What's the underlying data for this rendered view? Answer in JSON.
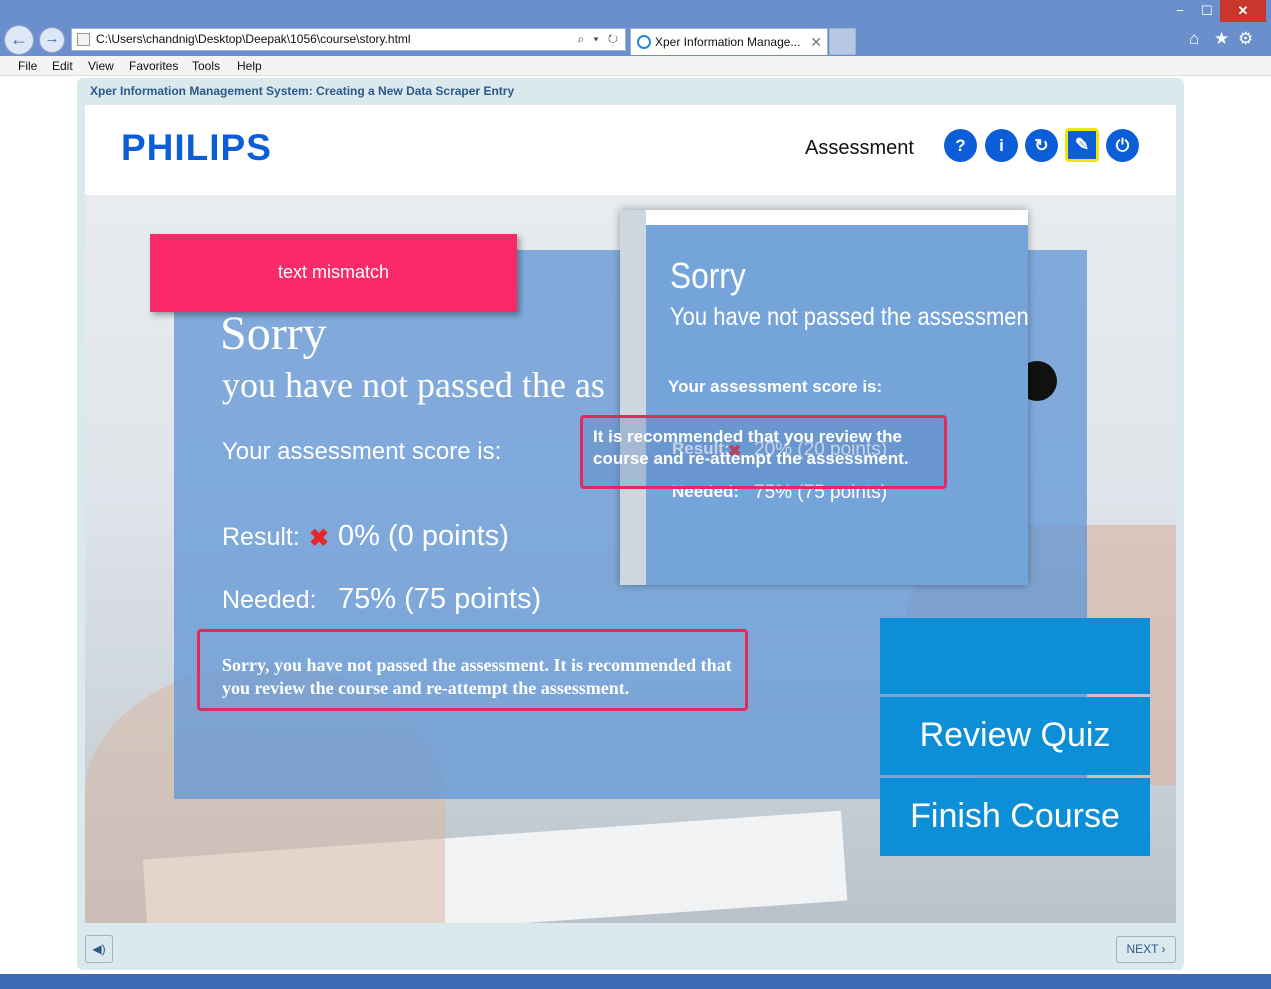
{
  "browser": {
    "address": "C:\\Users\\chandnig\\Desktop\\Deepak\\1056\\course\\story.html",
    "address_tools": "⌕ ▾ ↻",
    "tab_title": "Xper Information Manage...",
    "tab_close": "✕",
    "window_min": "−",
    "window_max": "☐",
    "window_close": "✕",
    "toolbar_icons": {
      "home": "⌂",
      "favorites": "★",
      "tools": "⚙"
    }
  },
  "menu": [
    "File",
    "Edit",
    "View",
    "Favorites",
    "Tools",
    "Help"
  ],
  "course": {
    "title": "Xper Information Management System: Creating a New Data Scraper Entry",
    "brand": "PHILIPS",
    "section": "Assessment",
    "header_buttons": {
      "help": "?",
      "info": "i",
      "replay": "↻",
      "compass": "✎",
      "power": "⏻"
    }
  },
  "result": {
    "sorry": "Sorry",
    "not_passed": "you have not passed the as",
    "score_label": "Your assessment score is:",
    "result_label": "Result:",
    "result_value": "0% (0 points)",
    "needed_label": "Needed:",
    "needed_value": "75% (75 points)",
    "message": "Sorry, you have not passed the assessment. It is recommended that you review the course and re-attempt the assessment."
  },
  "buttons": {
    "review_quiz": "Review Quiz",
    "finish_course": "Finish Course"
  },
  "annotation": {
    "mismatch_tag": "text mismatch"
  },
  "reference": {
    "sorry": "Sorry",
    "not_passed": "You have not passed the assessmen",
    "score_label": "Your assessment score is:",
    "result_label": "Result:",
    "result_value": "20% (20 points)",
    "needed_label": "Needed:",
    "needed_value": "75% (75 points)",
    "message": "It is recommended that you review the course and re-attempt the assessment."
  },
  "footer": {
    "audio": "◀)",
    "next": "NEXT ›"
  },
  "colors": {
    "brand_blue": "#0b5ed7",
    "button_blue": "#0c8fd6",
    "highlight_pink": "#fa2a6a",
    "fail_red": "#e3272b"
  }
}
